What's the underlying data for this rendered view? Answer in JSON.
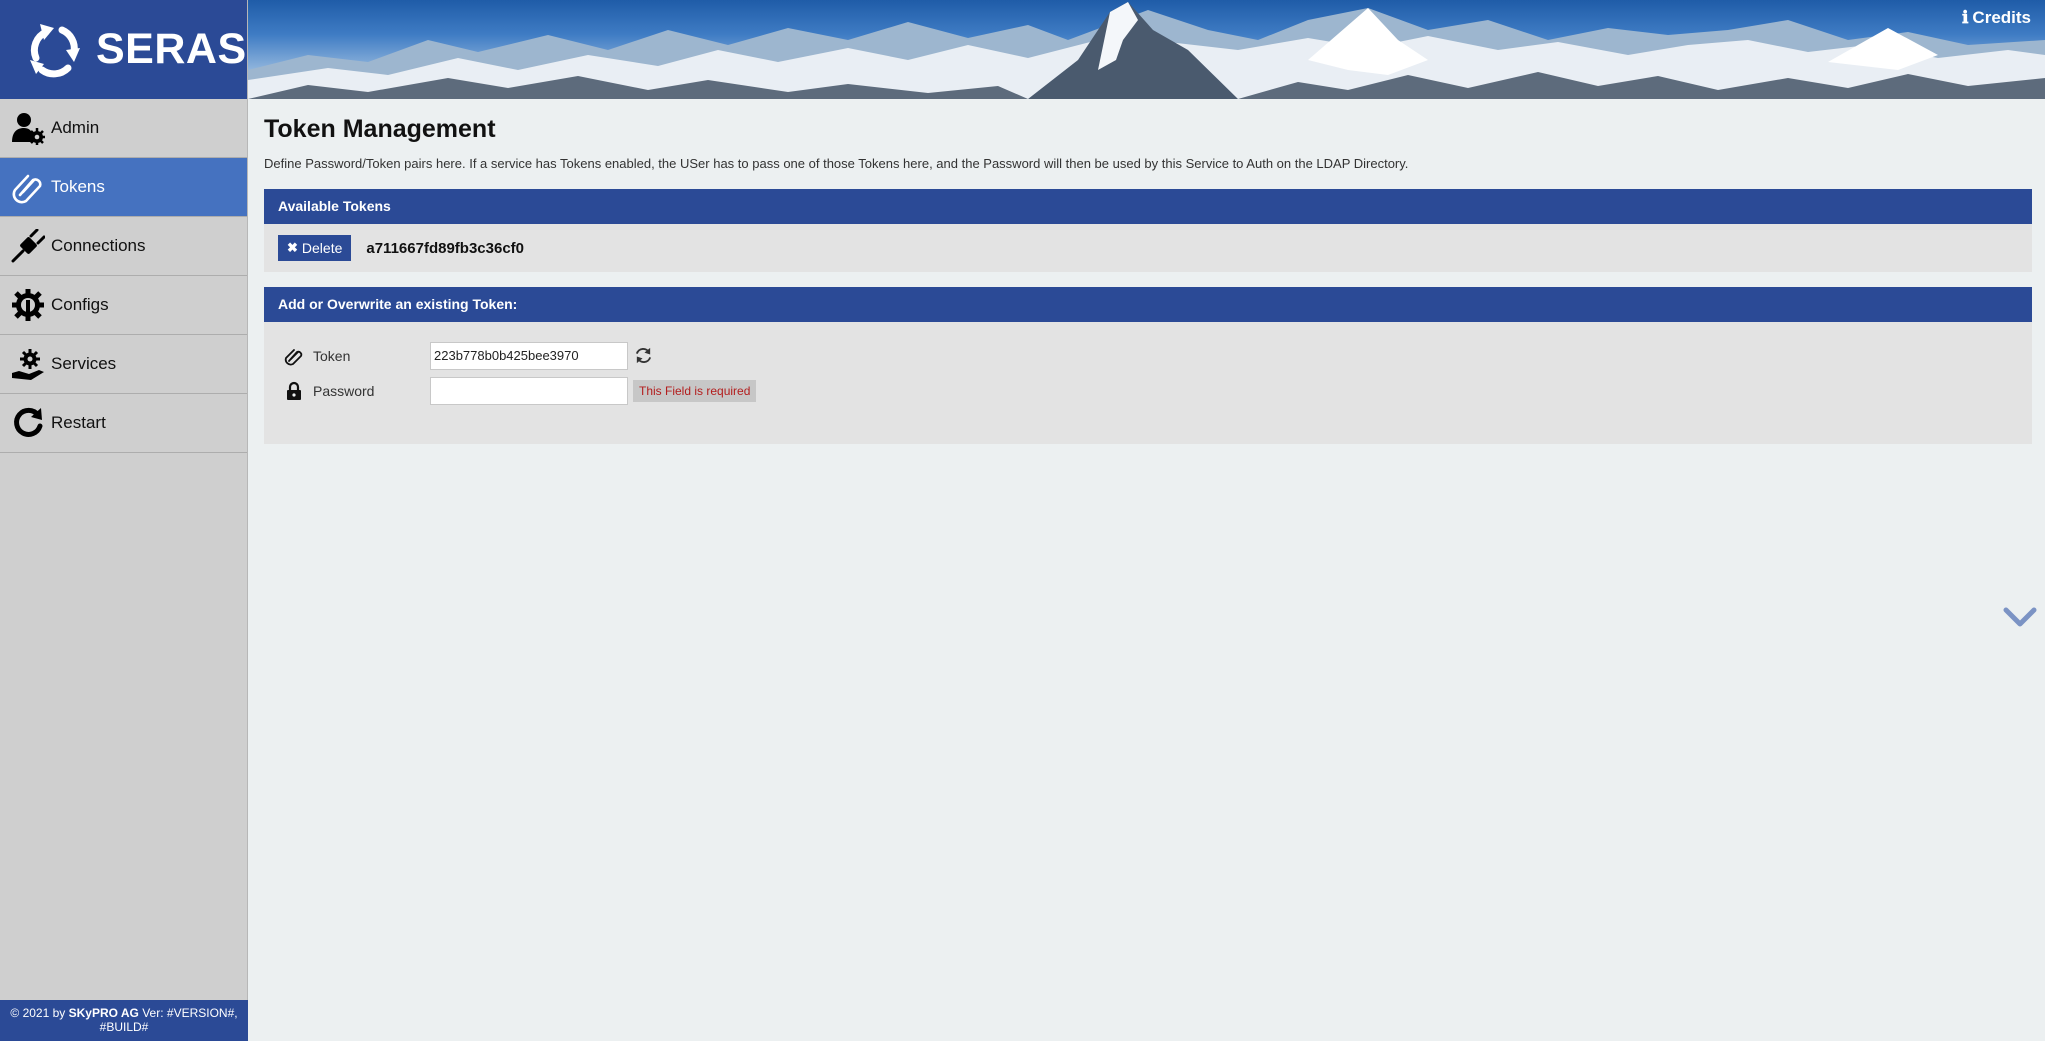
{
  "app": {
    "name": "SERAS"
  },
  "header": {
    "credits_label": "Credits",
    "credits_icon": "info-icon"
  },
  "sidebar": {
    "items": [
      {
        "label": "Admin",
        "icon": "admin-user-gear-icon",
        "active": false
      },
      {
        "label": "Tokens",
        "icon": "paperclip-icon",
        "active": true
      },
      {
        "label": "Connections",
        "icon": "plug-icon",
        "active": false
      },
      {
        "label": "Configs",
        "icon": "gear-wrench-icon",
        "active": false
      },
      {
        "label": "Services",
        "icon": "hand-gear-icon",
        "active": false
      },
      {
        "label": "Restart",
        "icon": "restart-icon",
        "active": false
      }
    ],
    "footer_prefix": "2021 by ",
    "footer_company": "SKyPRO AG",
    "footer_suffix": " Ver: #VERSION#, #BUILD#"
  },
  "main": {
    "title": "Token Management",
    "description": "Define Password/Token pairs here. If a service has Tokens enabled, the USer has to pass one of those Tokens here, and the Password will then be used by this Service to Auth on the LDAP Directory.",
    "available": {
      "heading": "Available Tokens",
      "delete_label": "Delete",
      "tokens": [
        "a711667fd89fb3c36cf0"
      ]
    },
    "form": {
      "heading": "Add or Overwrite an existing Token:",
      "token_label": "Token",
      "token_value": "223b778b0b425bee3970",
      "password_label": "Password",
      "password_value": "",
      "password_error": "This Field is required"
    }
  },
  "colors": {
    "brand": "#2b4a96",
    "active_nav": "#4572c0",
    "error_text": "#b31d1d"
  }
}
